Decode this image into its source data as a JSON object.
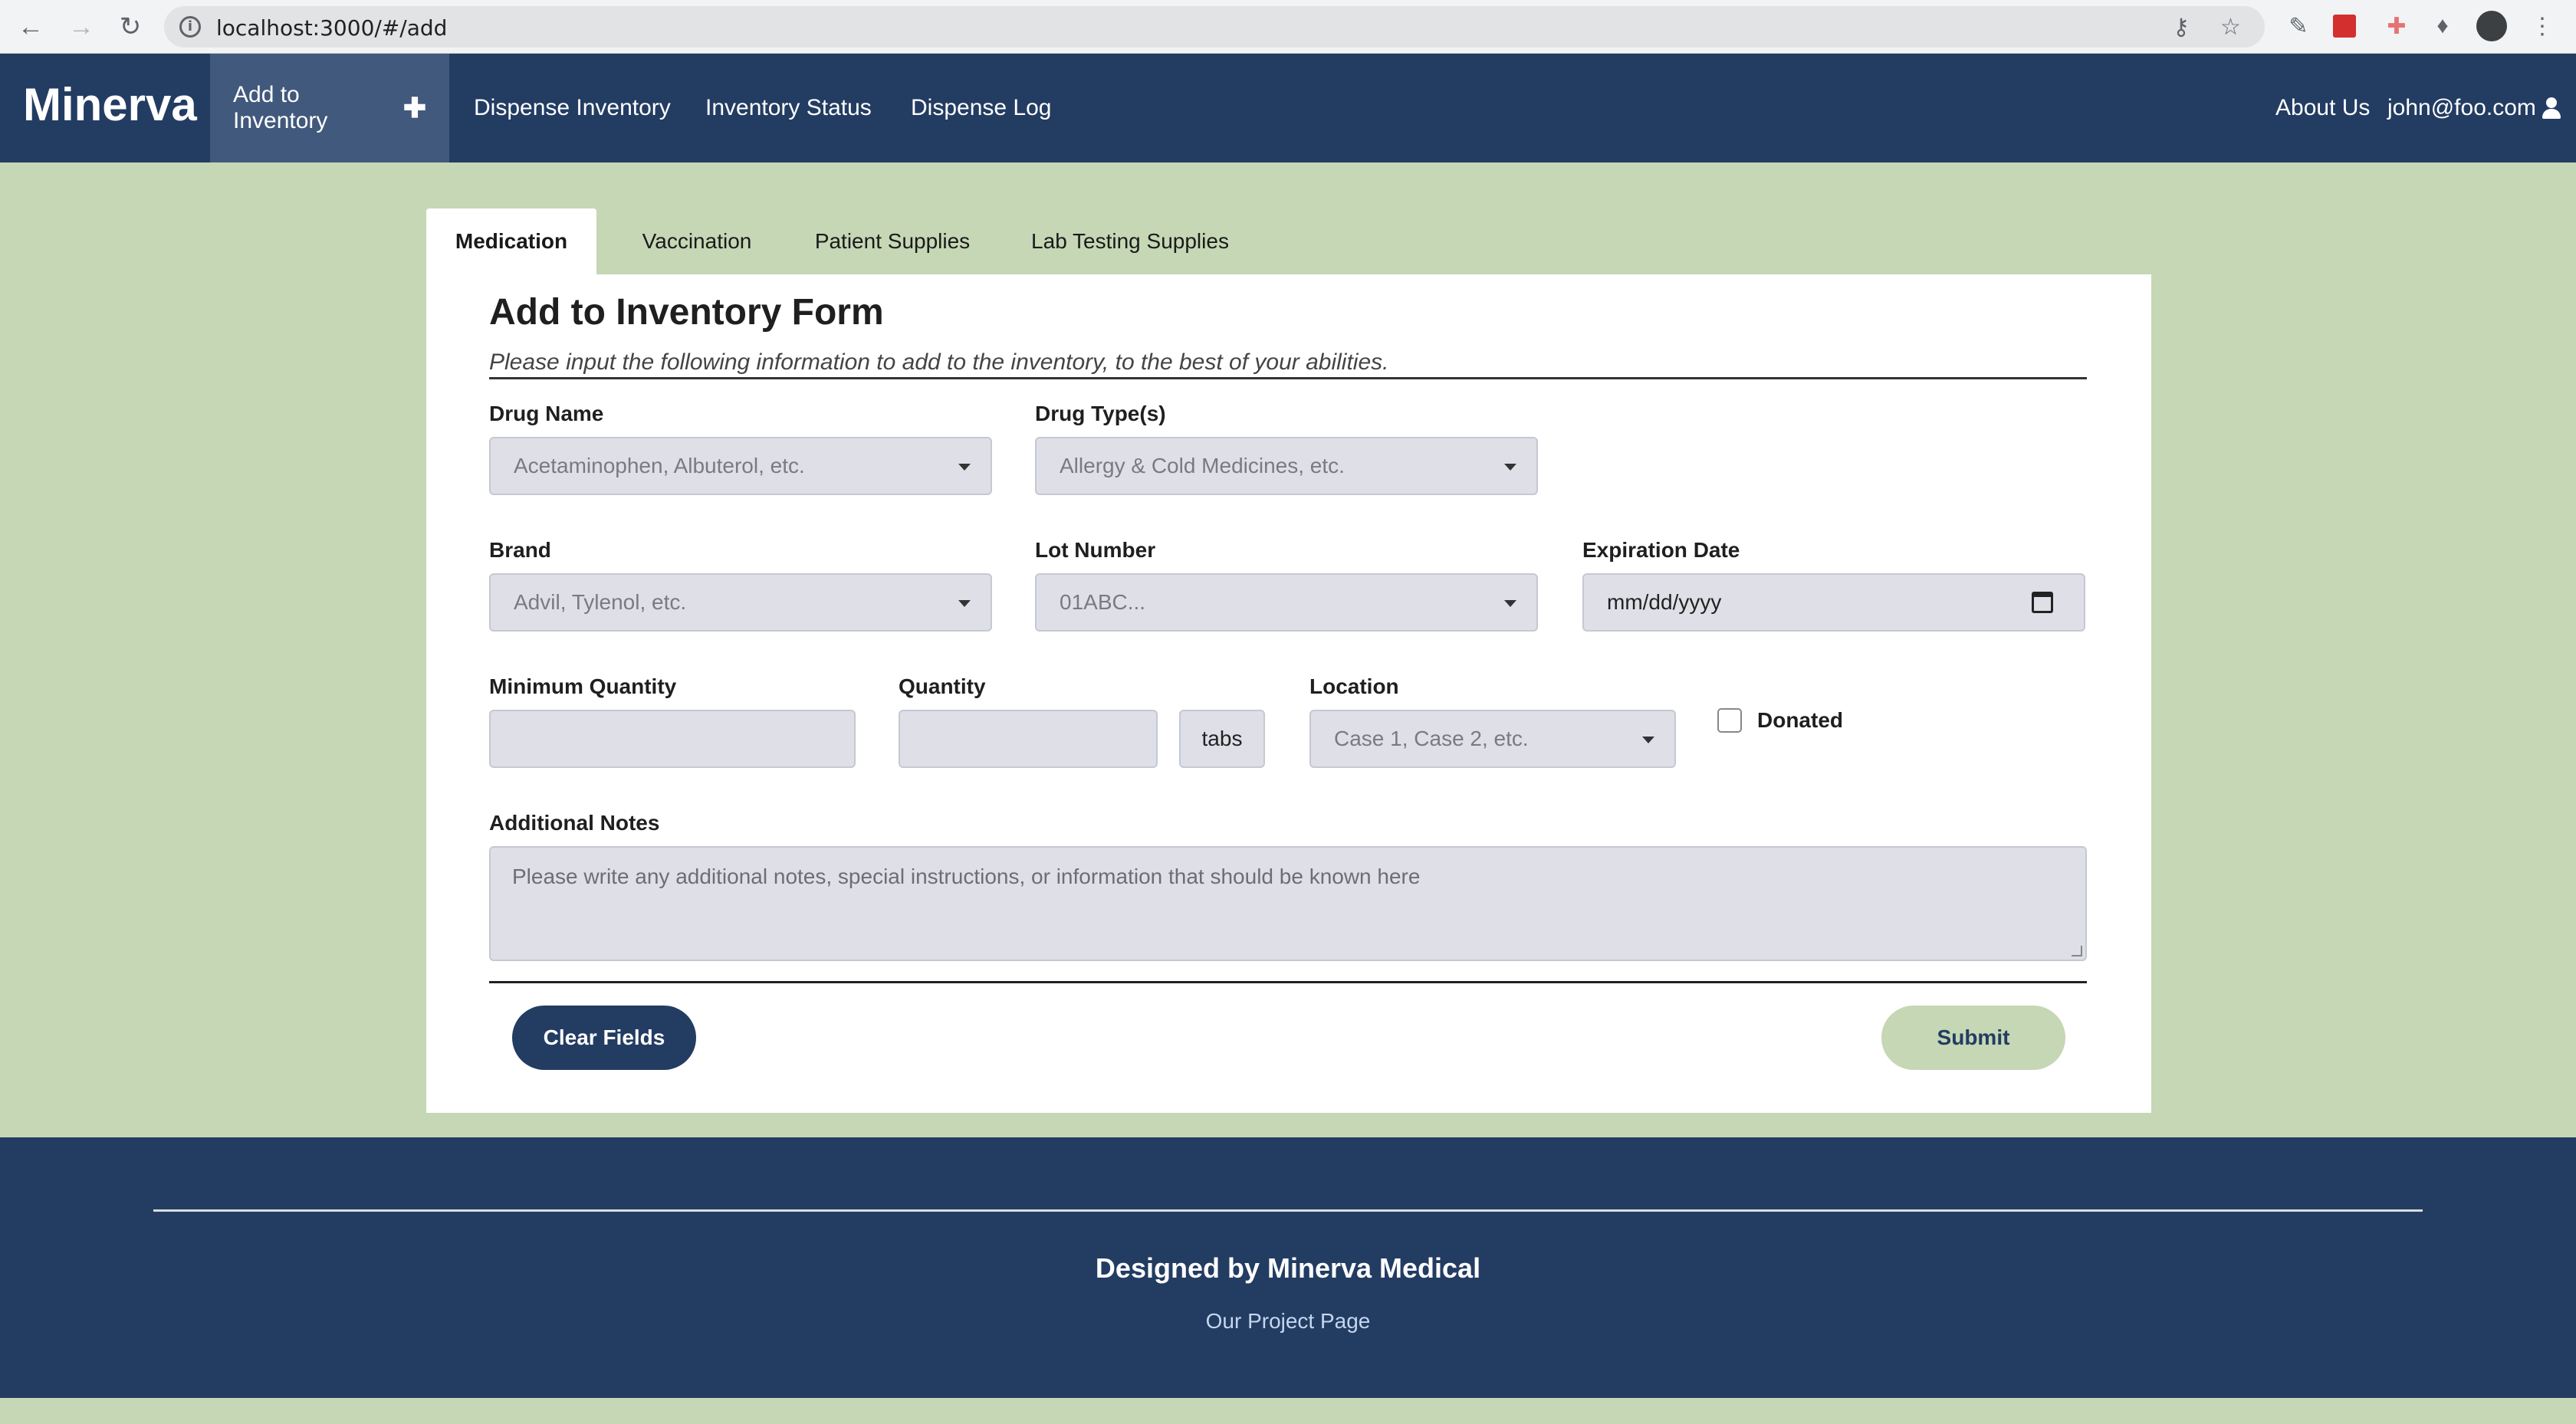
{
  "browser": {
    "url": "localhost:3000/#/add",
    "info_glyph": "i"
  },
  "navbar": {
    "brand": "Minerva",
    "items": [
      {
        "label": "Add to Inventory",
        "active": true
      },
      {
        "label": "Dispense Inventory"
      },
      {
        "label": "Inventory Status"
      },
      {
        "label": "Dispense Log"
      }
    ],
    "right": {
      "about": "About Us",
      "user": "john@foo.com"
    }
  },
  "tabs": [
    {
      "label": "Medication",
      "active": true
    },
    {
      "label": "Vaccination"
    },
    {
      "label": "Patient Supplies"
    },
    {
      "label": "Lab Testing Supplies"
    }
  ],
  "form": {
    "title": "Add to Inventory Form",
    "subtitle": "Please input the following information to add to the inventory, to the best of your abilities.",
    "drug_name": {
      "label": "Drug Name",
      "placeholder": "Acetaminophen, Albuterol, etc."
    },
    "drug_type": {
      "label": "Drug Type(s)",
      "placeholder": "Allergy & Cold Medicines, etc."
    },
    "brand": {
      "label": "Brand",
      "placeholder": "Advil, Tylenol, etc."
    },
    "lot_number": {
      "label": "Lot Number",
      "placeholder": "01ABC..."
    },
    "expiration_date": {
      "label": "Expiration Date",
      "placeholder": "mm/dd/yyyy"
    },
    "minimum_quantity": {
      "label": "Minimum Quantity",
      "value": ""
    },
    "quantity": {
      "label": "Quantity",
      "value": "",
      "unit": "tabs"
    },
    "location": {
      "label": "Location",
      "placeholder": "Case 1, Case 2, etc."
    },
    "donated": {
      "label": "Donated",
      "checked": false
    },
    "notes": {
      "label": "Additional Notes",
      "placeholder": "Please write any additional notes, special instructions, or information that should be known here"
    },
    "clear_button": "Clear Fields",
    "submit_button": "Submit"
  },
  "footer": {
    "title": "Designed by Minerva Medical",
    "link": "Our Project Page"
  },
  "colors": {
    "primary": "#233c62",
    "background": "#c5d7b5",
    "field": "#dfe0e7"
  }
}
